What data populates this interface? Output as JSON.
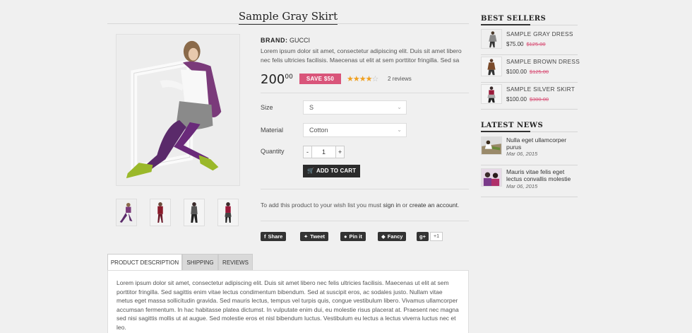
{
  "product": {
    "title": "Sample Gray Skirt",
    "brand_label": "BRAND:",
    "brand_value": "GUCCI",
    "short_description": "Lorem ipsum dolor sit amet, consectetur adipiscing elit. Duis sit amet libero nec felis ultricies facilisis. Maecenas ut elit at sem porttitor fringilla. Sed sa",
    "price_main": "200",
    "price_cents": "00",
    "save_badge": "SAVE $50",
    "rating": 4,
    "rating_max": 5,
    "reviews_text": "2 reviews",
    "options": {
      "size_label": "Size",
      "size_value": "S",
      "material_label": "Material",
      "material_value": "Cotton",
      "quantity_label": "Quantity",
      "quantity_value": "1",
      "minus_label": "-",
      "plus_label": "+"
    },
    "add_to_cart_label": "ADD TO CART",
    "wishlist": {
      "prefix": "To add this product to your wish list you must ",
      "sign_in": "sign in",
      "middle": " or ",
      "create": "create an account",
      "suffix": "."
    },
    "social": {
      "share": "Share",
      "tweet": "Tweet",
      "pin": "Pin it",
      "fancy": "Fancy",
      "gplus": "g+",
      "gplus_count": "+1"
    },
    "tabs": [
      "PRODUCT DESCRIPTION",
      "SHIPPING",
      "REVIEWS"
    ],
    "full_description": "Lorem ipsum dolor sit amet, consectetur adipiscing elit. Duis sit amet libero nec felis ultricies facilisis. Maecenas ut elit at sem porttitor fringilla. Sed sagittis enim vitae lectus condimentum bibendum. Sed at suscipit eros, ac sodales justo. Nullam vitae metus eget massa sollicitudin gravida. Sed mauris lectus, tempus vel turpis quis, congue vestibulum libero. Vivamus ullamcorper accumsan fermentum. In hac habitasse platea dictumst. In vulputate enim dui, eu molestie risus placerat at. Praesent nec magna sed nisi sagittis mollis ut at augue. Sed molestie eros et nisl bibendum luctus. Vestibulum eu lectus a lectus viverra luctus nec et leo."
  },
  "sidebar": {
    "best_sellers_heading": "BEST SELLERS",
    "best_sellers": [
      {
        "name": "SAMPLE GRAY DRESS",
        "price": "$75.00",
        "old_price": "$125.00"
      },
      {
        "name": "SAMPLE BROWN DRESS",
        "price": "$100.00",
        "old_price": "$125.00"
      },
      {
        "name": "SAMPLE SILVER SKIRT",
        "price": "$100.00",
        "old_price": "$300.00"
      }
    ],
    "latest_news_heading": "LATEST NEWS",
    "latest_news": [
      {
        "title": "Nulla eget ullamcorper purus",
        "date": "Mar 06, 2015"
      },
      {
        "title": "Mauris vitae felis eget lectus convallis molestie",
        "date": "Mar 06, 2015"
      }
    ]
  },
  "icons": {
    "cart": "cart-icon",
    "facebook": "facebook-icon",
    "twitter": "twitter-icon",
    "pinterest": "pinterest-icon",
    "fancy": "fancy-icon",
    "google_plus": "google-plus-icon",
    "chevron": "chevron-down-icon",
    "star": "star-icon"
  },
  "colors": {
    "accent_pink": "#d9557a",
    "star_gold": "#f0a020",
    "button_dark": "#2b2b2b",
    "page_bg": "#f0f0f0"
  }
}
